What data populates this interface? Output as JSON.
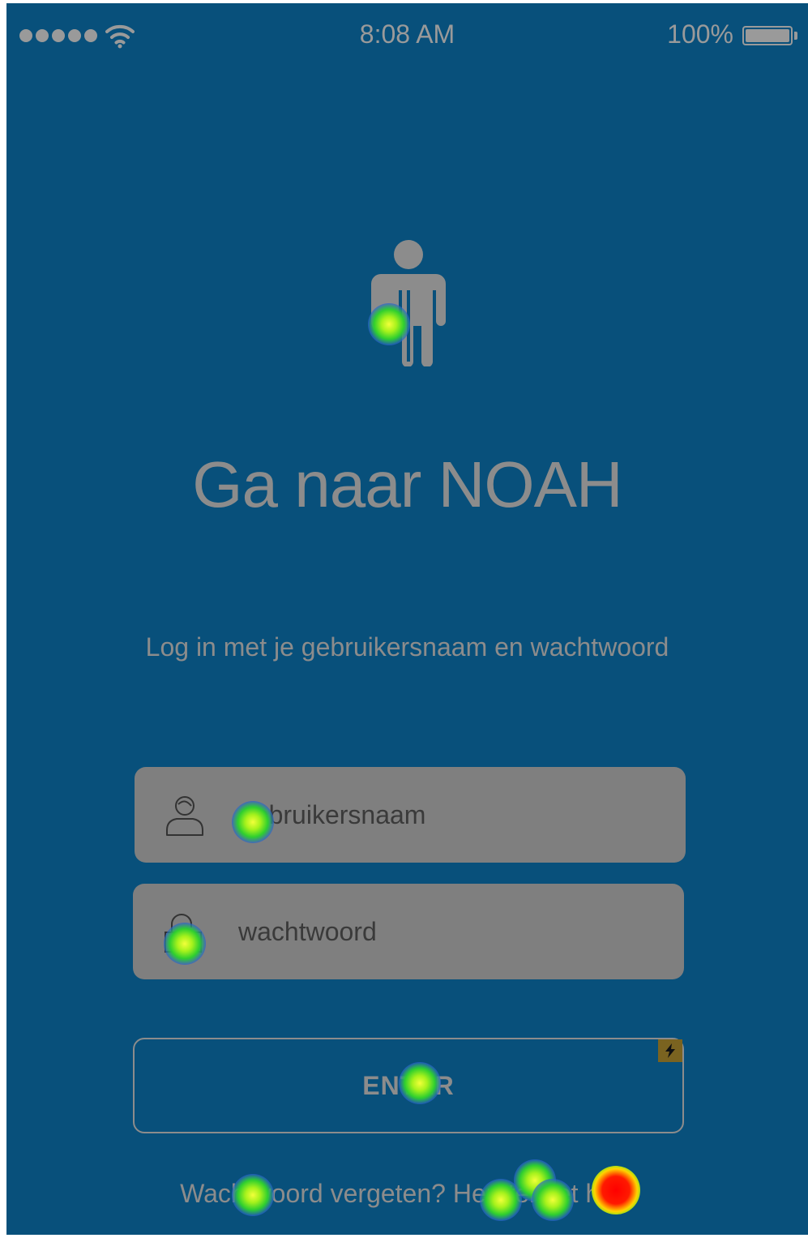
{
  "status_bar": {
    "time": "8:08 AM",
    "battery": "100%",
    "signal_icon": "signal-dots-icon",
    "wifi_icon": "wifi-icon",
    "battery_icon": "battery-icon"
  },
  "hero": {
    "icon": "person-icon",
    "title": "Ga naar NOAH",
    "subtitle": "Log in met je gebruikersnaam en wachtwoord"
  },
  "form": {
    "username": {
      "placeholder": "gebruikersnaam",
      "value": "",
      "icon": "user-icon"
    },
    "password": {
      "placeholder": "wachtwoord",
      "value": "",
      "icon": "unlock-icon"
    },
    "enter_label": "ENTER",
    "flash_icon": "lightning-icon"
  },
  "footer": {
    "forgot_text": "Wachtwoord vergeten? ",
    "reset_link": "Herstel het hier."
  },
  "colors": {
    "background": "#08507b",
    "text": "#8c8c8c",
    "field": "#7f7f7f"
  }
}
